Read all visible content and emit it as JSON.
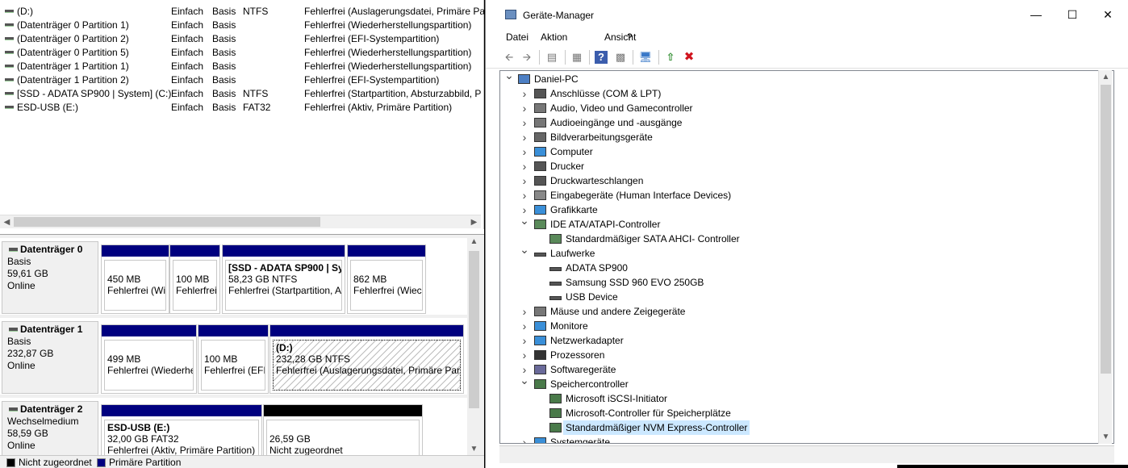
{
  "disk_mgmt": {
    "volumes": [
      {
        "name": "(D:)",
        "layout": "Einfach",
        "type": "Basis",
        "fs": "NTFS",
        "status": "Fehlerfrei (Auslagerungsdatei, Primäre Pa"
      },
      {
        "name": "(Datenträger 0 Partition 1)",
        "layout": "Einfach",
        "type": "Basis",
        "fs": "",
        "status": "Fehlerfrei (Wiederherstellungspartition)"
      },
      {
        "name": "(Datenträger 0 Partition 2)",
        "layout": "Einfach",
        "type": "Basis",
        "fs": "",
        "status": "Fehlerfrei (EFI-Systempartition)"
      },
      {
        "name": "(Datenträger 0 Partition 5)",
        "layout": "Einfach",
        "type": "Basis",
        "fs": "",
        "status": "Fehlerfrei (Wiederherstellungspartition)"
      },
      {
        "name": "(Datenträger 1 Partition 1)",
        "layout": "Einfach",
        "type": "Basis",
        "fs": "",
        "status": "Fehlerfrei (Wiederherstellungspartition)"
      },
      {
        "name": "(Datenträger 1 Partition 2)",
        "layout": "Einfach",
        "type": "Basis",
        "fs": "",
        "status": "Fehlerfrei (EFI-Systempartition)"
      },
      {
        "name": "[SSD - ADATA SP900 | System] (C:)",
        "layout": "Einfach",
        "type": "Basis",
        "fs": "NTFS",
        "status": "Fehlerfrei (Startpartition, Absturzabbild, P"
      },
      {
        "name": "ESD-USB (E:)",
        "layout": "Einfach",
        "type": "Basis",
        "fs": "FAT32",
        "status": "Fehlerfrei (Aktiv, Primäre Partition)"
      }
    ],
    "disks": [
      {
        "name": "Datenträger 0",
        "kind": "Basis",
        "size": "59,61 GB",
        "state": "Online",
        "parts": [
          {
            "title": "",
            "size": "450 MB",
            "status": "Fehlerfrei (Wi"
          },
          {
            "title": "",
            "size": "100 MB",
            "status": "Fehlerfrei"
          },
          {
            "title": "[SSD - ADATA SP900 | Sy",
            "size": "58,23 GB NTFS",
            "status": "Fehlerfrei (Startpartition, A"
          },
          {
            "title": "",
            "size": "862 MB",
            "status": "Fehlerfrei (Wiec"
          }
        ]
      },
      {
        "name": "Datenträger 1",
        "kind": "Basis",
        "size": "232,87 GB",
        "state": "Online",
        "parts": [
          {
            "title": "",
            "size": "499 MB",
            "status": "Fehlerfrei (Wiederhe"
          },
          {
            "title": "",
            "size": "100 MB",
            "status": "Fehlerfrei (EFI-"
          },
          {
            "title": "(D:)",
            "size": "232,28 GB NTFS",
            "status": "Fehlerfrei (Auslagerungsdatei, Primäre Part"
          }
        ]
      },
      {
        "name": "Datenträger 2",
        "kind": "Wechselmedium",
        "size": "58,59 GB",
        "state": "Online",
        "parts": [
          {
            "title": "ESD-USB  (E:)",
            "size": "32,00 GB FAT32",
            "status": "Fehlerfrei (Aktiv, Primäre Partition)"
          },
          {
            "title": "",
            "size": "26,59 GB",
            "status": "Nicht zugeordnet"
          }
        ]
      }
    ],
    "legend": [
      {
        "label": "Nicht zugeordnet",
        "color": "#000000"
      },
      {
        "label": "Primäre Partition",
        "color": "#00007f"
      }
    ]
  },
  "devmgr": {
    "title": "Geräte-Manager",
    "menus": [
      "Datei",
      "Aktion",
      "Ansicht",
      "?"
    ],
    "toolbar": [
      "back-icon",
      "forward-icon",
      "properties-icon",
      "view-icon",
      "help-icon",
      "show-hidden-icon",
      "scan-hardware-icon",
      "update-driver-icon",
      "uninstall-icon"
    ],
    "tree": [
      {
        "label": "Daniel-PC",
        "level": 0,
        "exp": "open",
        "icon": "computer"
      },
      {
        "label": "Anschlüsse (COM & LPT)",
        "level": 1,
        "exp": "closed",
        "icon": "port"
      },
      {
        "label": "Audio, Video und Gamecontroller",
        "level": 1,
        "exp": "closed",
        "icon": "audio"
      },
      {
        "label": "Audioeingänge und -ausgänge",
        "level": 1,
        "exp": "closed",
        "icon": "audio"
      },
      {
        "label": "Bildverarbeitungsgeräte",
        "level": 1,
        "exp": "closed",
        "icon": "camera"
      },
      {
        "label": "Computer",
        "level": 1,
        "exp": "closed",
        "icon": "monitor"
      },
      {
        "label": "Drucker",
        "level": 1,
        "exp": "closed",
        "icon": "printer"
      },
      {
        "label": "Druckwarteschlangen",
        "level": 1,
        "exp": "closed",
        "icon": "printer"
      },
      {
        "label": "Eingabegeräte (Human Interface Devices)",
        "level": 1,
        "exp": "closed",
        "icon": "hid"
      },
      {
        "label": "Grafikkarte",
        "level": 1,
        "exp": "closed",
        "icon": "monitor"
      },
      {
        "label": "IDE ATA/ATAPI-Controller",
        "level": 1,
        "exp": "open",
        "icon": "controller"
      },
      {
        "label": "Standardmäßiger SATA AHCI- Controller",
        "level": 2,
        "exp": "",
        "icon": "controller"
      },
      {
        "label": "Laufwerke",
        "level": 1,
        "exp": "open",
        "icon": "drive"
      },
      {
        "label": "ADATA SP900",
        "level": 2,
        "exp": "",
        "icon": "drive"
      },
      {
        "label": "Samsung SSD 960 EVO 250GB",
        "level": 2,
        "exp": "",
        "icon": "drive"
      },
      {
        "label": "USB Device",
        "level": 2,
        "exp": "",
        "icon": "drive"
      },
      {
        "label": "Mäuse und andere Zeigegeräte",
        "level": 1,
        "exp": "closed",
        "icon": "mouse"
      },
      {
        "label": "Monitore",
        "level": 1,
        "exp": "closed",
        "icon": "monitor"
      },
      {
        "label": "Netzwerkadapter",
        "level": 1,
        "exp": "closed",
        "icon": "network"
      },
      {
        "label": "Prozessoren",
        "level": 1,
        "exp": "closed",
        "icon": "cpu"
      },
      {
        "label": "Softwaregeräte",
        "level": 1,
        "exp": "closed",
        "icon": "software"
      },
      {
        "label": "Speichercontroller",
        "level": 1,
        "exp": "open",
        "icon": "storage"
      },
      {
        "label": "Microsoft iSCSI-Initiator",
        "level": 2,
        "exp": "",
        "icon": "storage"
      },
      {
        "label": "Microsoft-Controller für Speicherplätze",
        "level": 2,
        "exp": "",
        "icon": "storage"
      },
      {
        "label": "Standardmäßiger NVM Express-Controller",
        "level": 2,
        "exp": "",
        "icon": "storage",
        "selected": true
      },
      {
        "label": "Systemgeräte",
        "level": 1,
        "exp": "closed",
        "icon": "monitor"
      }
    ]
  },
  "colors": {
    "primary": "#00007f",
    "unallocated": "#000000",
    "selection": "#cce8ff"
  }
}
